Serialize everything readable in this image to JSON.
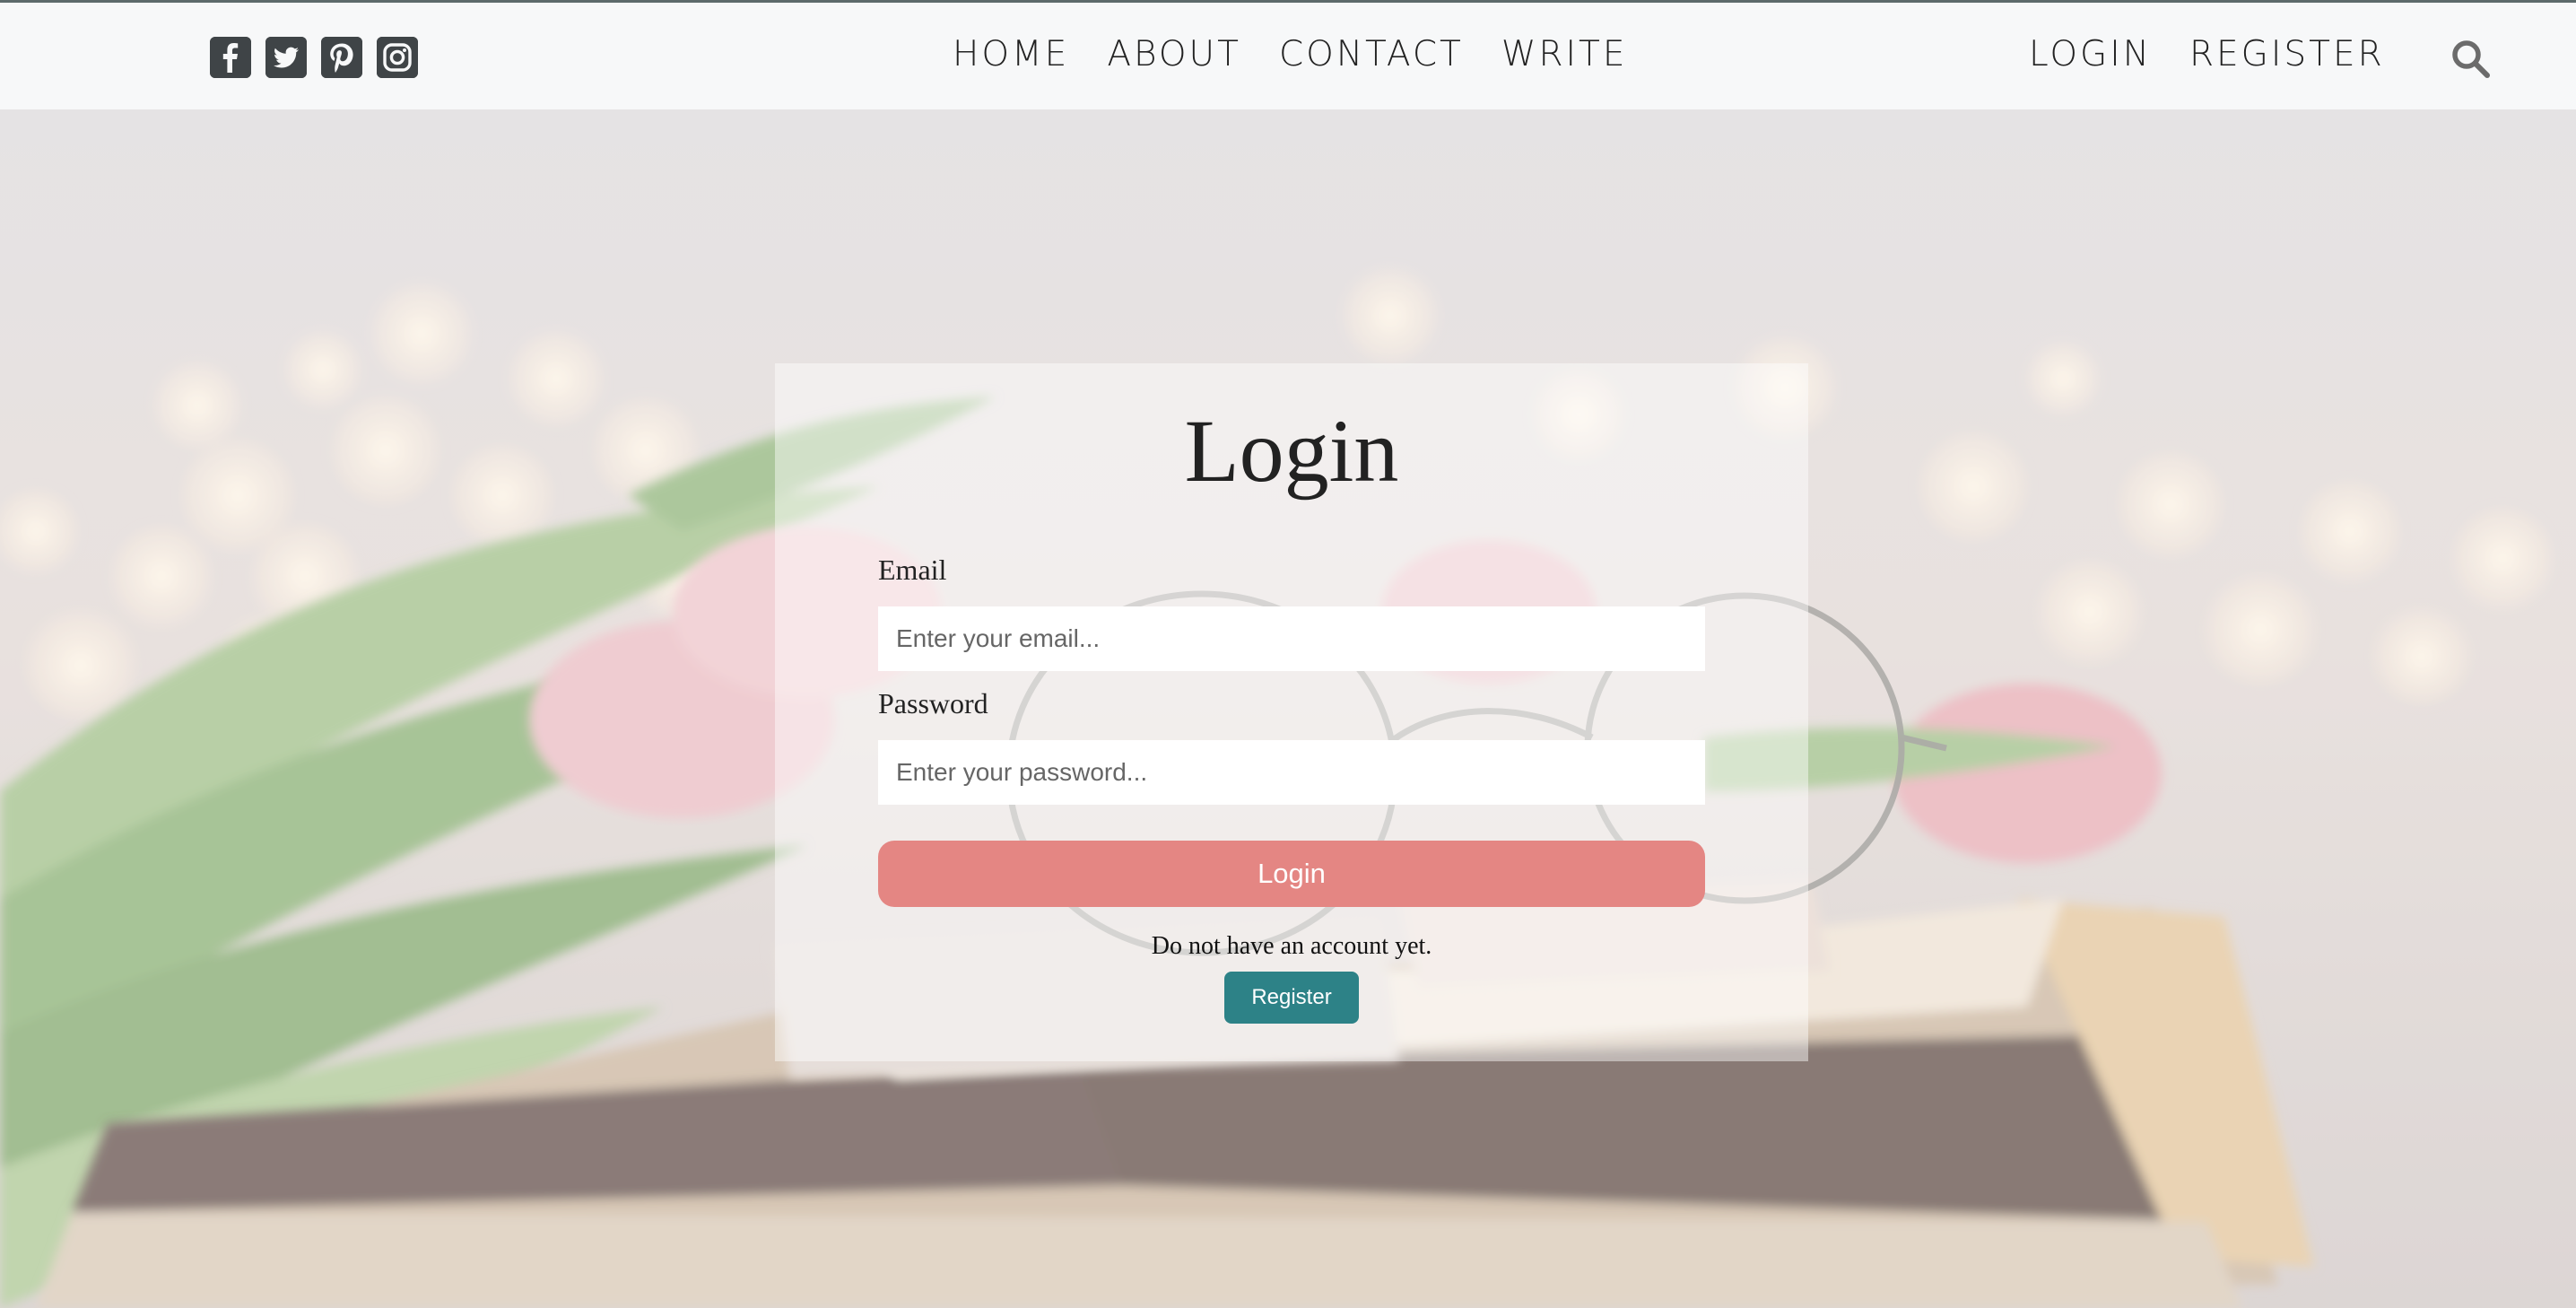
{
  "header": {
    "social": [
      {
        "icon": "facebook-square-icon"
      },
      {
        "icon": "twitter-square-icon"
      },
      {
        "icon": "pinterest-square-icon"
      },
      {
        "icon": "instagram-square-icon"
      }
    ],
    "nav": [
      "HOME",
      "ABOUT",
      "CONTACT",
      "WRITE"
    ],
    "auth": [
      "LOGIN",
      "REGISTER"
    ],
    "search_icon": "search-icon"
  },
  "login": {
    "title": "Login",
    "email_label": "Email",
    "email_placeholder": "Enter your email...",
    "email_value": "",
    "password_label": "Password",
    "password_placeholder": "Enter your password...",
    "password_value": "",
    "submit_label": "Login",
    "no_account_text": "Do not have an account yet.",
    "register_label": "Register"
  },
  "colors": {
    "login_button": "#e48683",
    "register_button": "#2d8287",
    "icon": "#3f4447"
  }
}
